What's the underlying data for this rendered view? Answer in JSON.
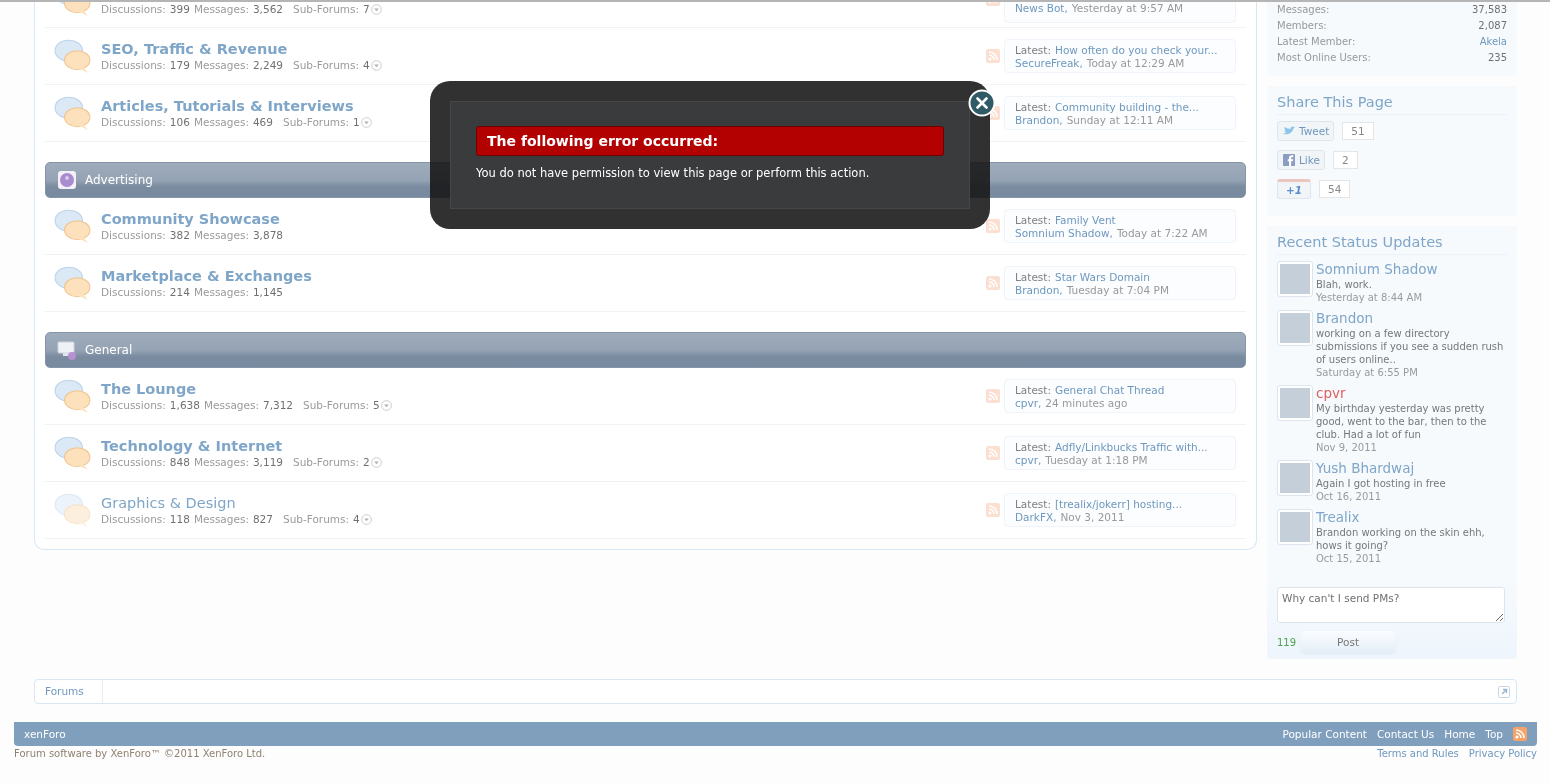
{
  "categories": [
    {
      "forums": [
        {
          "unread": true,
          "stats": [
            {
              "kind": "count",
              "label": "Discussions:",
              "value": "399"
            },
            {
              "kind": "count",
              "label": "Messages:",
              "value": "3,562"
            },
            {
              "kind": "subforums",
              "label": "Sub-Forums:",
              "value": "7"
            }
          ],
          "latest": {
            "author": "News Bot,",
            "time": "Yesterday at 9:57 AM"
          }
        },
        {
          "name": "SEO, Traffic & Revenue",
          "unread": true,
          "stats": [
            {
              "kind": "count",
              "label": "Discussions:",
              "value": "179"
            },
            {
              "kind": "count",
              "label": "Messages:",
              "value": "2,249"
            },
            {
              "kind": "subforums",
              "label": "Sub-Forums:",
              "value": "4"
            }
          ],
          "latest": {
            "label": "Latest:",
            "title": "How often do you check your...",
            "author": "SecureFreak,",
            "time": "Today at 12:29 AM"
          }
        },
        {
          "name": "Articles, Tutorials & Interviews",
          "unread": true,
          "stats": [
            {
              "kind": "count",
              "label": "Discussions:",
              "value": "106"
            },
            {
              "kind": "count",
              "label": "Messages:",
              "value": "469"
            },
            {
              "kind": "subforums",
              "label": "Sub-Forums:",
              "value": "1"
            }
          ],
          "latest": {
            "label": "Latest:",
            "title": "Community building - the...",
            "author": "Brandon,",
            "time": "Sunday at 12:11 AM"
          }
        }
      ]
    },
    {
      "title": "Advertising",
      "forums": [
        {
          "name": "Community Showcase",
          "unread": true,
          "stats": [
            {
              "kind": "count",
              "label": "Discussions:",
              "value": "382"
            },
            {
              "kind": "count",
              "label": "Messages:",
              "value": "3,878"
            }
          ],
          "latest": {
            "label": "Latest:",
            "title": "Family Vent",
            "author": "Somnium Shadow,",
            "time": "Today at 7:22 AM"
          }
        },
        {
          "name": "Marketplace & Exchanges",
          "unread": true,
          "stats": [
            {
              "kind": "count",
              "label": "Discussions:",
              "value": "214"
            },
            {
              "kind": "count",
              "label": "Messages:",
              "value": "1,145"
            }
          ],
          "latest": {
            "label": "Latest:",
            "title": "Star Wars Domain",
            "author": "Brandon,",
            "time": "Tuesday at 7:04 PM"
          }
        }
      ]
    },
    {
      "title": "General",
      "forums": [
        {
          "name": "The Lounge",
          "unread": true,
          "stats": [
            {
              "kind": "count",
              "label": "Discussions:",
              "value": "1,638"
            },
            {
              "kind": "count",
              "label": "Messages:",
              "value": "7,312"
            },
            {
              "kind": "subforums",
              "label": "Sub-Forums:",
              "value": "5"
            }
          ],
          "latest": {
            "label": "Latest:",
            "title": "General Chat Thread",
            "author": "cpvr,",
            "time": "24 minutes ago"
          }
        },
        {
          "name": "Technology & Internet",
          "unread": true,
          "stats": [
            {
              "kind": "count",
              "label": "Discussions:",
              "value": "848"
            },
            {
              "kind": "count",
              "label": "Messages:",
              "value": "3,119"
            },
            {
              "kind": "subforums",
              "label": "Sub-Forums:",
              "value": "2"
            }
          ],
          "latest": {
            "label": "Latest:",
            "title": "Adfly/Linkbucks Traffic with...",
            "author": "cpvr,",
            "time": "Tuesday at 1:18 PM"
          }
        },
        {
          "name": "Graphics & Design",
          "unread": false,
          "stats": [
            {
              "kind": "count",
              "label": "Discussions:",
              "value": "118"
            },
            {
              "kind": "count",
              "label": "Messages:",
              "value": "827"
            },
            {
              "kind": "subforums",
              "label": "Sub-Forums:",
              "value": "4"
            }
          ],
          "latest": {
            "label": "Latest:",
            "title": "[trealix/jokerr] hosting...",
            "author": "DarkFX,",
            "time": "Nov 3, 2011"
          }
        }
      ]
    }
  ],
  "sidebar": {
    "stats": [
      {
        "label": "Messages:",
        "value": "37,583",
        "link": false
      },
      {
        "label": "Members:",
        "value": "2,087",
        "link": false
      },
      {
        "label": "Latest Member:",
        "value": "Akela",
        "link": true
      },
      {
        "label": "Most Online Users:",
        "value": "235",
        "link": false
      }
    ],
    "share": {
      "title": "Share This Page",
      "buttons": [
        {
          "kind": "tweet",
          "label": "Tweet",
          "count": "51"
        },
        {
          "kind": "like",
          "label": "Like",
          "count": "2"
        },
        {
          "kind": "plusone",
          "label": "+1",
          "count": "54"
        }
      ]
    },
    "status": {
      "title": "Recent Status Updates",
      "items": [
        {
          "name": "Somnium Shadow",
          "color": "#7fa6c8",
          "text": "Blah, work.",
          "time": "Yesterday at 8:44 AM"
        },
        {
          "name": "Brandon",
          "color": "#7fa6c8",
          "text": "working on a few directory submissions if you see a sudden rush of users online..",
          "time": "Saturday at 6:55 PM"
        },
        {
          "name": "cpvr",
          "color": "#e06060",
          "text": "My birthday yesterday was pretty good, went to the bar, then to the club. Had a lot of fun",
          "time": "Nov 9, 2011"
        },
        {
          "name": "Yush Bhardwaj",
          "color": "#7fa6c8",
          "text": "Again I got hosting in free",
          "time": "Oct 16, 2011"
        },
        {
          "name": "Trealix",
          "color": "#7fa6c8",
          "text": "Brandon working on the skin ehh, hows it going?",
          "time": "Oct 15, 2011"
        }
      ],
      "input": "Why can't I send PMs?",
      "counter": "119",
      "button": "Post"
    }
  },
  "breadcrumb": [
    "Forums"
  ],
  "footer": {
    "brand": "xenForo",
    "links": [
      "Popular Content",
      "Contact Us",
      "Home",
      "Top"
    ],
    "copyright": "Forum software by XenForo™ ©2011 XenForo Ltd.",
    "legal": [
      "Terms and Rules",
      "Privacy Policy"
    ]
  },
  "modal": {
    "title": "The following error occurred:",
    "message": "You do not have permission to view this page or perform this action."
  }
}
